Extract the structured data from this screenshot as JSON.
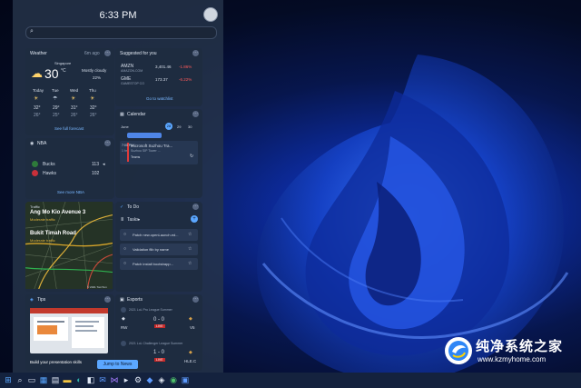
{
  "clock": {
    "time": "6:33 PM"
  },
  "weather": {
    "title": "Weather",
    "updated": "6m ago",
    "location": "Singapore",
    "temp": "30",
    "unit": "°C",
    "condition": "Mostly cloudy",
    "precip": "22%",
    "days": [
      {
        "day": "Today",
        "hi": "32°",
        "lo": "26°"
      },
      {
        "day": "Tue",
        "hi": "29°",
        "lo": "25°"
      },
      {
        "day": "Wed",
        "hi": "31°",
        "lo": "26°"
      },
      {
        "day": "Thu",
        "hi": "32°",
        "lo": "26°"
      }
    ],
    "link": "See full forecast"
  },
  "stocks": {
    "title": "Suggested for you",
    "rows": [
      {
        "symbol": "AMZN",
        "name": "AMAZON.COM",
        "price": "3,401.46",
        "change": "-1.86%"
      },
      {
        "symbol": "GME",
        "name": "GAMESTOP CO",
        "price": "173.37",
        "change": "-6.22%"
      }
    ],
    "link": "Go to watchlist"
  },
  "calendar": {
    "title": "Calendar",
    "month": "June",
    "dates": [
      "28",
      "29",
      "30"
    ],
    "event": {
      "time": "7:00 PM",
      "duration": "1 hr",
      "title": "Microsoft Suzhou Tra...",
      "location": "Suzhou SIP Tower ...",
      "join": "Teams"
    }
  },
  "nba": {
    "title": "NBA",
    "teams": [
      {
        "name": "Bucks",
        "score": "113"
      },
      {
        "name": "Hawks",
        "score": "102"
      }
    ],
    "link": "See more NBA"
  },
  "traffic": {
    "title": "Traffic",
    "location": "Ang Mo Kio Avenue 3",
    "status": "Moderate traffic",
    "road": "Bukit Timah Road",
    "road_status": "Moderate traffic",
    "credit": "© 2021 TomTom"
  },
  "todo": {
    "title": "To Do",
    "list": "Tasks",
    "items": [
      "Patch new.openLaunch.ed...",
      "Validation flib by name",
      "Patch install bootstrapp..."
    ]
  },
  "tips": {
    "title": "Tips",
    "caption": "Build your presentation skills",
    "button": "Jump to News"
  },
  "esports": {
    "title": "Esports",
    "matches": [
      {
        "league": "2021 LoL Pro League Summer",
        "left": "RW",
        "score": "0 - 0",
        "right": "V5",
        "status": "LIVE"
      },
      {
        "league": "2021 LoL Challenger League Summer",
        "left": "",
        "score": "1 - 0",
        "right": "HLE.C",
        "status": "LIVE"
      }
    ]
  },
  "watermark": {
    "title": "纯净系统之家",
    "url": "www.kzmyhome.com"
  },
  "colors": {
    "accent": "#5ba7ff",
    "negative": "#ff5a5a"
  }
}
